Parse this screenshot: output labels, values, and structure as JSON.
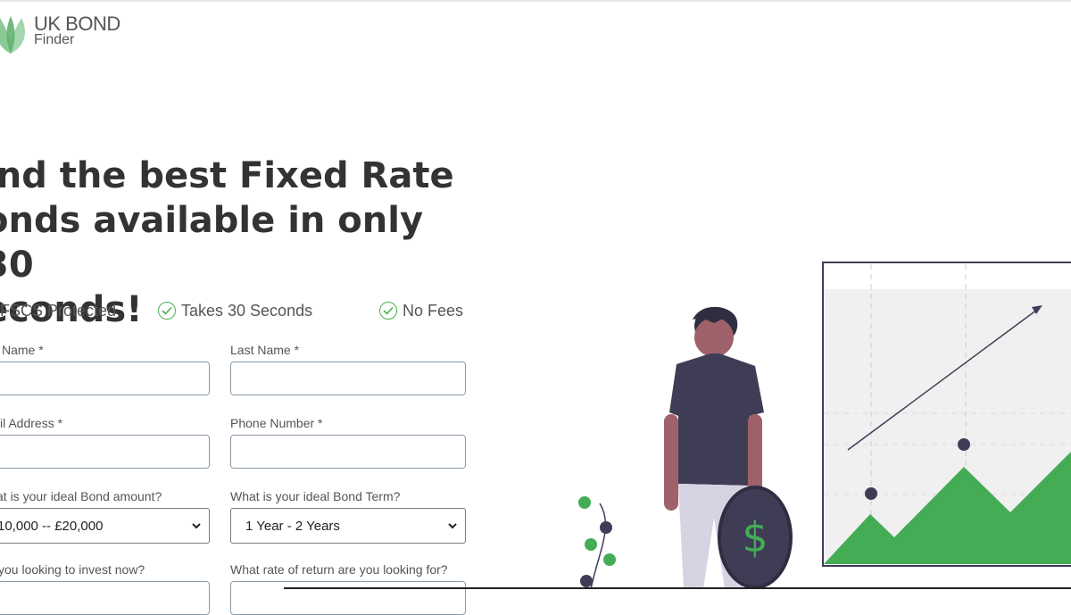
{
  "brand": {
    "line1": "UK BOND",
    "line2": "Finder",
    "leaf_color": "#7cc48a"
  },
  "hero": {
    "line1": "ind the best Fixed Rate",
    "line2": "onds available in only 30",
    "line3": "econds!"
  },
  "features": [
    {
      "label": "FSCS Protected",
      "icon": "check-circle-icon"
    },
    {
      "label": "Takes 30 Seconds",
      "icon": "check-circle-icon"
    },
    {
      "label": "No Fees",
      "icon": "check-circle-icon"
    }
  ],
  "form": {
    "first_name_label": "Name *",
    "last_name_label": "Last Name *",
    "email_label": "il Address *",
    "phone_label": "Phone Number *",
    "amount_label": "at is your ideal Bond amount?",
    "amount_value": "10,000 -- £20,000",
    "term_label": "What is your ideal Bond Term?",
    "term_value": "1 Year - 2 Years",
    "invest_now_label": "you looking to invest now?",
    "rate_label": "What rate of return are you looking for?"
  },
  "illustration": {
    "coin_symbol": "$",
    "accent_color": "#43ac55",
    "dark_color": "#3f3d56"
  }
}
